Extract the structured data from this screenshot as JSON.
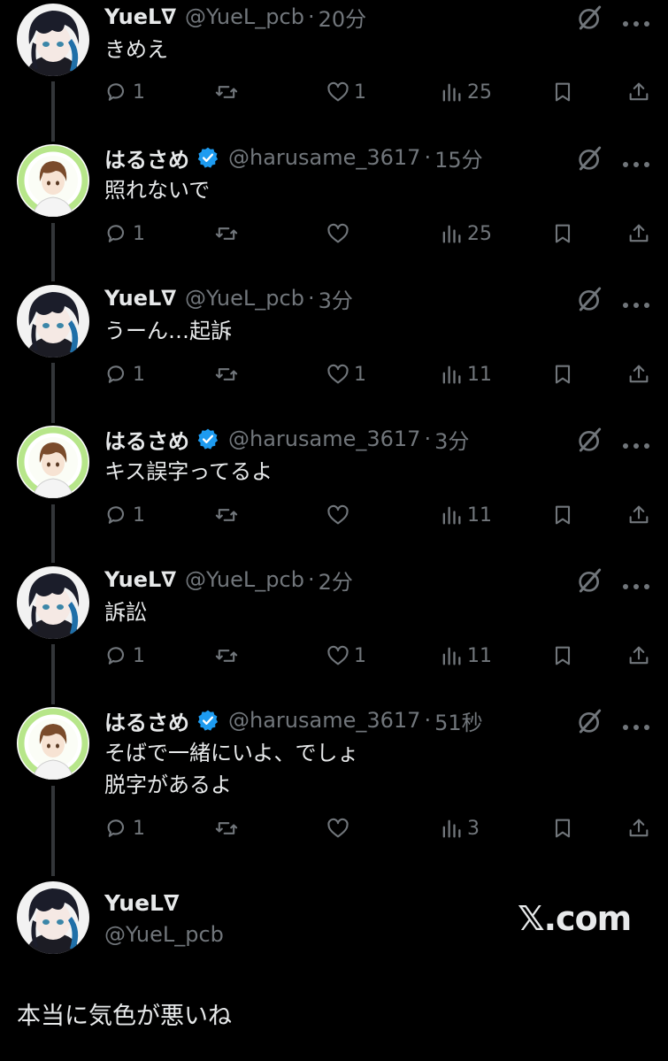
{
  "tweets": [
    {
      "name": "YueL∇",
      "verified": false,
      "handle": "@YueL_pcb",
      "time": "20分",
      "text": "きめえ",
      "replies": "1",
      "retweets": "",
      "likes": "1",
      "views": "25",
      "avatar": "yuel"
    },
    {
      "name": "はるさめ",
      "verified": true,
      "handle": "@harusame_3617",
      "time": "15分",
      "text": "照れないで",
      "replies": "1",
      "retweets": "",
      "likes": "",
      "views": "25",
      "avatar": "harusame"
    },
    {
      "name": "YueL∇",
      "verified": false,
      "handle": "@YueL_pcb",
      "time": "3分",
      "text": "うーん…起訴",
      "replies": "1",
      "retweets": "",
      "likes": "1",
      "views": "11",
      "avatar": "yuel"
    },
    {
      "name": "はるさめ",
      "verified": true,
      "handle": "@harusame_3617",
      "time": "3分",
      "text": "キス誤字ってるよ",
      "replies": "1",
      "retweets": "",
      "likes": "",
      "views": "11",
      "avatar": "harusame"
    },
    {
      "name": "YueL∇",
      "verified": false,
      "handle": "@YueL_pcb",
      "time": "2分",
      "text": "訴訟",
      "replies": "1",
      "retweets": "",
      "likes": "1",
      "views": "11",
      "avatar": "yuel"
    },
    {
      "name": "はるさめ",
      "verified": true,
      "handle": "@harusame_3617",
      "time": "51秒",
      "text": "そばで一緒にいよ、でしょ\n脱字があるよ",
      "replies": "1",
      "retweets": "",
      "likes": "",
      "views": "3",
      "avatar": "harusame"
    }
  ],
  "final": {
    "name": "YueL∇",
    "handle": "@YueL_pcb",
    "text": "本当に気色が悪いね",
    "watermark": "𝕏.com"
  },
  "icons": [
    "reply-icon",
    "retweet-icon",
    "like-icon",
    "views-icon",
    "bookmark-icon",
    "share-icon",
    "grok-icon",
    "more-icon",
    "verified-icon"
  ],
  "colors": {
    "background": "#000000",
    "text": "#e7e9ea",
    "muted": "#71767b",
    "verified": "#1d9bf0",
    "thread_line": "#333639"
  }
}
